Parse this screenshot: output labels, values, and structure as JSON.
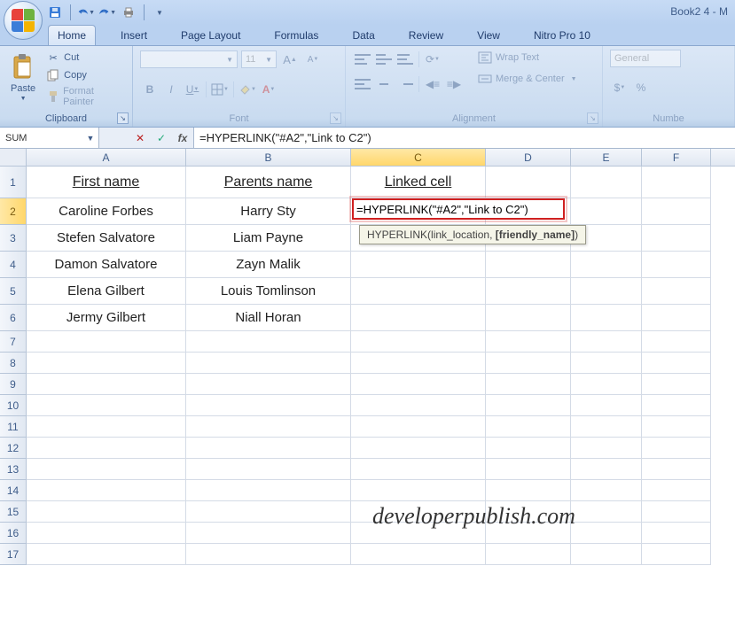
{
  "window": {
    "title": "Book2 4 - M"
  },
  "qat": {
    "save": "save",
    "undo": "undo",
    "redo": "redo",
    "print": "quick-print"
  },
  "tabs": [
    "Home",
    "Insert",
    "Page Layout",
    "Formulas",
    "Data",
    "Review",
    "View",
    "Nitro Pro 10"
  ],
  "active_tab": 0,
  "clipboard": {
    "paste": "Paste",
    "cut": "Cut",
    "copy": "Copy",
    "fmtpainter": "Format Painter",
    "label": "Clipboard"
  },
  "font": {
    "family_placeholder": "",
    "size": "11",
    "grow": "A",
    "shrink": "A",
    "bold": "B",
    "italic": "I",
    "underline": "U",
    "label": "Font"
  },
  "alignment": {
    "wrap": "Wrap Text",
    "merge": "Merge & Center",
    "label": "Alignment"
  },
  "number": {
    "format": "General",
    "label": "Numbe"
  },
  "namebox": "SUM",
  "formula": "=HYPERLINK(\"#A2\",\"Link to C2\")",
  "columns": [
    "A",
    "B",
    "C",
    "D",
    "E",
    "F"
  ],
  "active_col": 2,
  "active_row": 2,
  "headers": {
    "A": "First name",
    "B": "Parents name",
    "C": "Linked cell"
  },
  "rows_data": [
    {
      "A": "Caroline Forbes",
      "B": "Harry Sty"
    },
    {
      "A": "Stefen Salvatore",
      "B": "Liam Payne"
    },
    {
      "A": "Damon Salvatore",
      "B": "Zayn Malik"
    },
    {
      "A": "Elena Gilbert",
      "B": "Louis Tomlinson"
    },
    {
      "A": "Jermy Gilbert",
      "B": "Niall Horan"
    }
  ],
  "edit_cell": "=HYPERLINK(\"#A2\",\"Link to C2\")",
  "tooltip": {
    "fn": "HYPERLINK",
    "sig1": "(link_location, ",
    "sig2": "[friendly_name]",
    "sig3": ")"
  },
  "watermark": "developerpublish.com",
  "total_rows": 17
}
